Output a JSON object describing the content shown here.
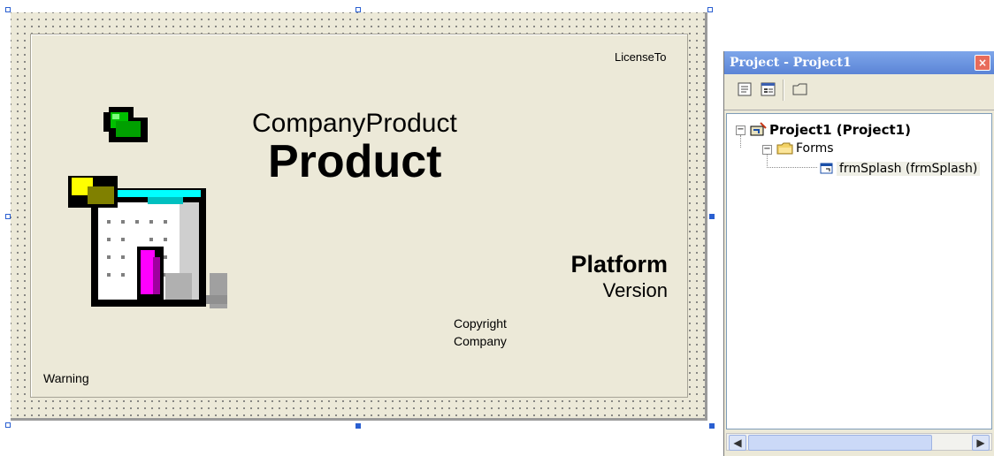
{
  "form": {
    "license_label": "LicenseTo",
    "company_product_label": "CompanyProduct",
    "product_label": "Product",
    "platform_label": "Platform",
    "version_label": "Version",
    "copyright_label": "Copyright",
    "company_label": "Company",
    "warning_label": "Warning",
    "logo_icon": "package-image-icon"
  },
  "project_explorer": {
    "title": "Project - Project1",
    "toolbar": [
      "view-code-icon",
      "view-object-icon",
      "toggle-folders-icon"
    ],
    "tree": {
      "project": "Project1 (Project1)",
      "folder": "Forms",
      "form": "frmSplash (frmSplash)"
    }
  },
  "colors": {
    "form_bg": "#ece9d8",
    "title_bar": "#6b93e0",
    "selection_handle": "#2a5fd1"
  }
}
